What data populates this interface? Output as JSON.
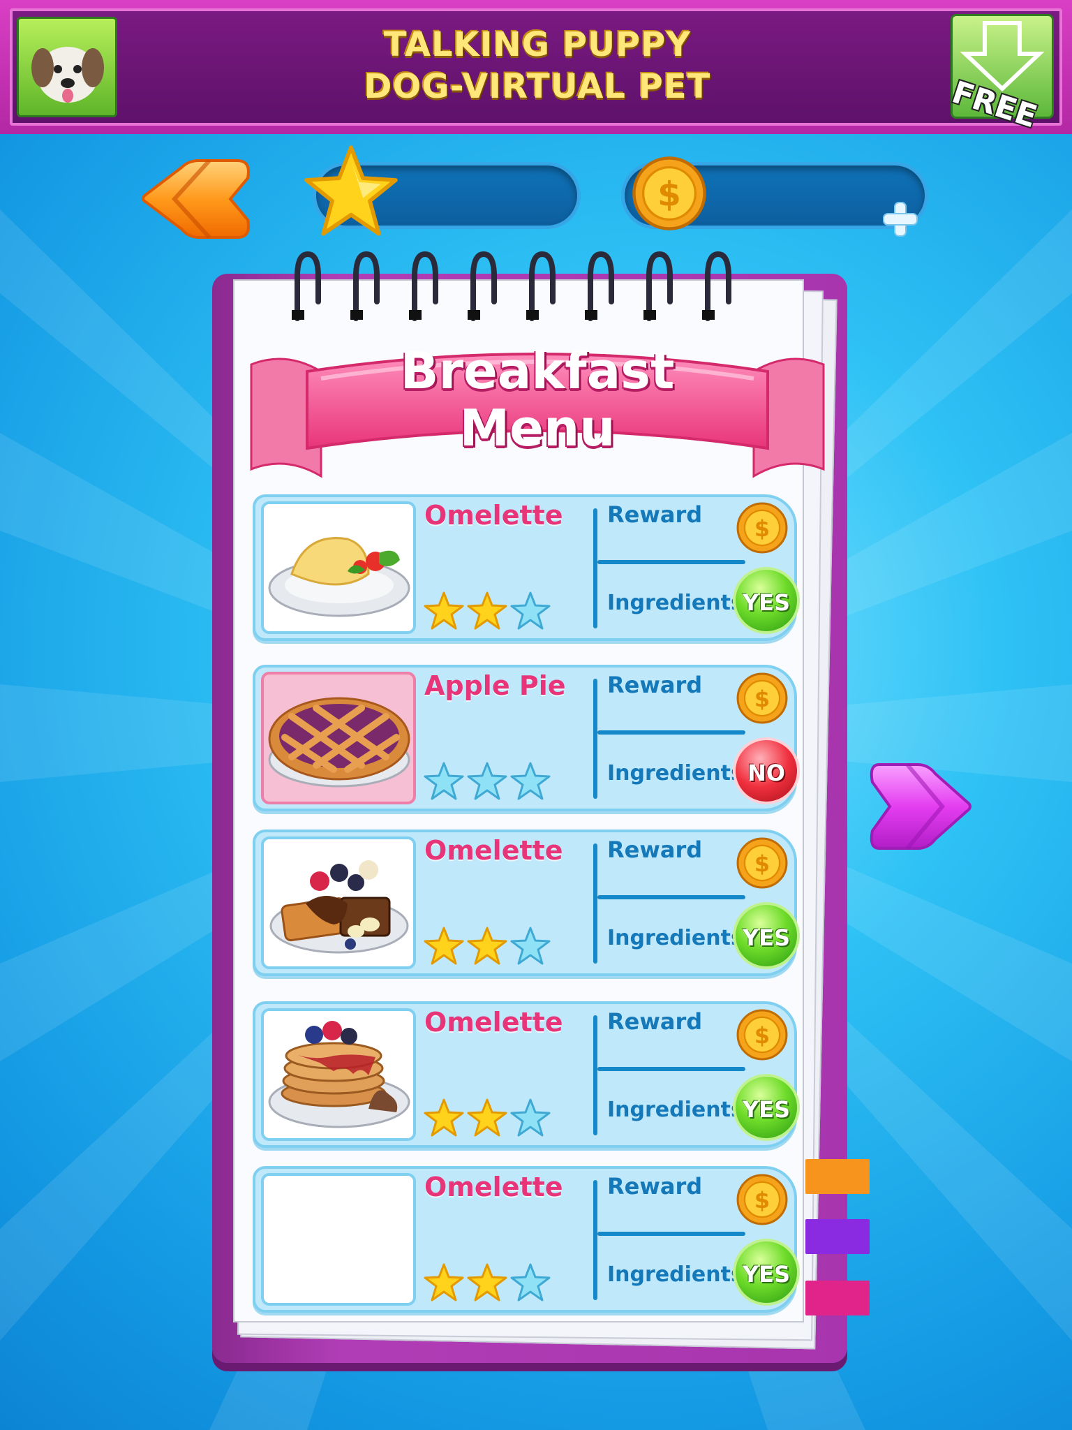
{
  "ad": {
    "title_line1": "TALKING PUPPY",
    "title_line2": "DOG-VIRTUAL PET",
    "badge": "FREE"
  },
  "hud": {
    "stars_value": "",
    "coins_value": "",
    "plus_icon": "plus-icon"
  },
  "menu": {
    "title_line1": "Breakfast",
    "title_line2": "Menu",
    "reward_label": "Reward",
    "ingredients_label": "Ingredients",
    "items": [
      {
        "name": "Omelette",
        "image": "omelette",
        "stars_earned": 2,
        "stars_total": 3,
        "ingredients": "YES",
        "locked": false
      },
      {
        "name": "Apple Pie",
        "image": "apple-pie",
        "stars_earned": 0,
        "stars_total": 3,
        "ingredients": "NO",
        "locked": true
      },
      {
        "name": "Omelette",
        "image": "waffles",
        "stars_earned": 2,
        "stars_total": 3,
        "ingredients": "YES",
        "locked": false
      },
      {
        "name": "Omelette",
        "image": "pancakes",
        "stars_earned": 2,
        "stars_total": 3,
        "ingredients": "YES",
        "locked": false
      },
      {
        "name": "Omelette",
        "image": "",
        "stars_earned": 2,
        "stars_total": 3,
        "ingredients": "YES",
        "locked": false
      }
    ]
  },
  "colors": {
    "accent_pink": "#e8357a",
    "label_blue": "#1578b8",
    "notebook_purple": "#a835ad",
    "tab_orange": "#f7941d",
    "tab_violet": "#8a2be2",
    "tab_magenta": "#e0248a"
  }
}
